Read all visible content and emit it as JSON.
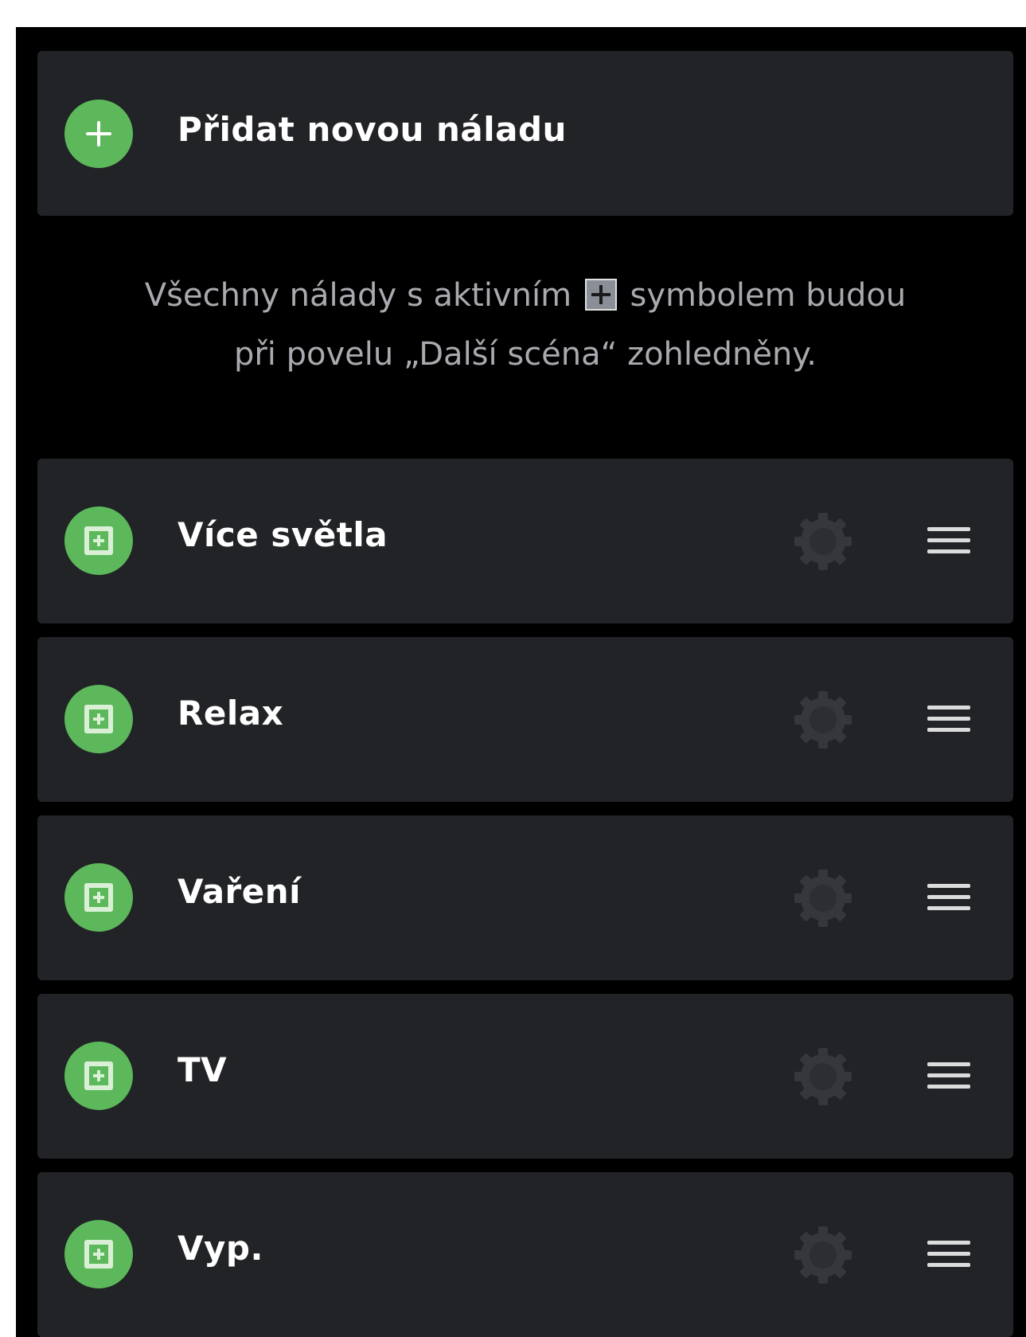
{
  "add_mood": {
    "label": "Přidat novou náladu",
    "icon": "plus-icon"
  },
  "info": {
    "text_before": "Všechny nálady s aktivním",
    "symbol_icon": "add-to-cycle-symbol-icon",
    "text_after_line1": "symbolem budou",
    "line2": "při povelu „Další scéna“ zohledněny."
  },
  "moods": [
    {
      "label": "Více světla"
    },
    {
      "label": "Relax"
    },
    {
      "label": "Vaření"
    },
    {
      "label": "TV"
    },
    {
      "label": "Vyp."
    }
  ],
  "colors": {
    "background": "#000000",
    "card": "#212326",
    "accent_green": "#5cb85a",
    "info_text": "#a9aaaf",
    "gear_disabled": "#35373b"
  }
}
